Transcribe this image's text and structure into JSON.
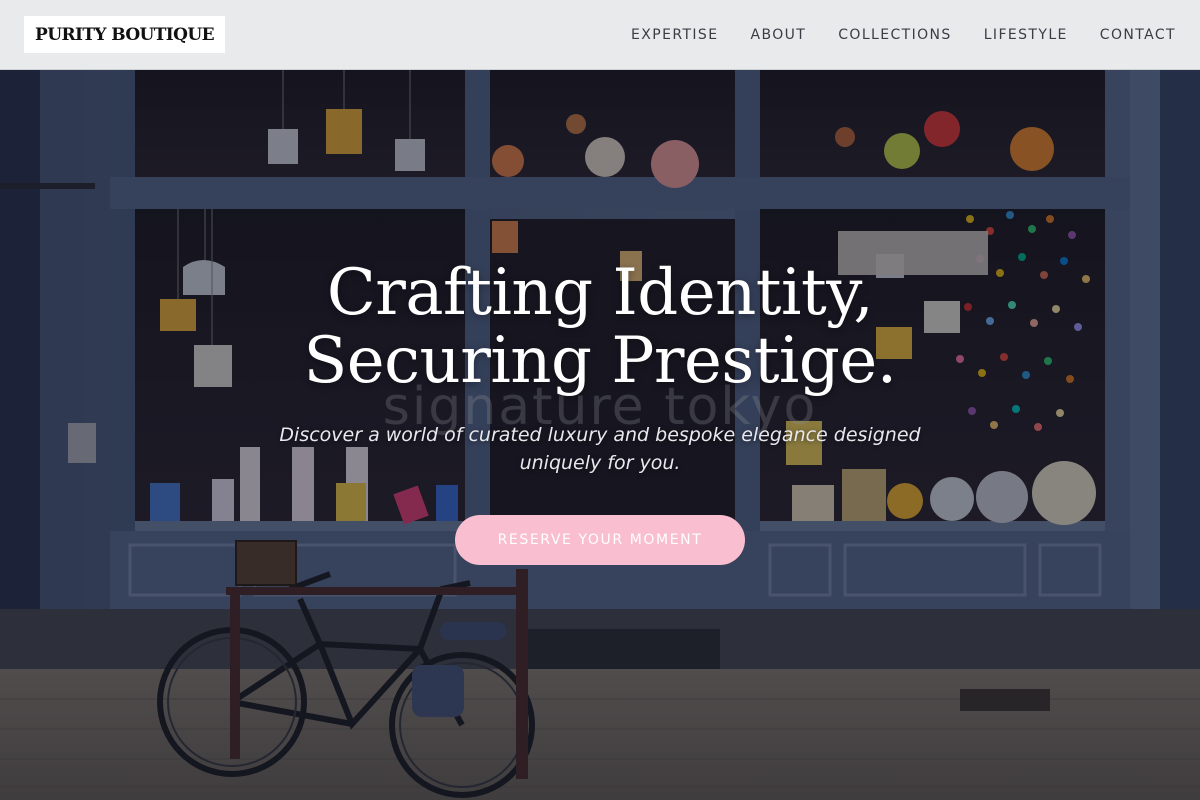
{
  "header": {
    "logo_text": "PURITY BOUTIQUE",
    "nav": [
      {
        "label": "EXPERTISE"
      },
      {
        "label": "ABOUT"
      },
      {
        "label": "COLLECTIONS"
      },
      {
        "label": "LIFESTYLE"
      },
      {
        "label": "CONTACT"
      }
    ]
  },
  "hero": {
    "title_line_1": "Crafting Identity,",
    "title_line_2": "Securing Prestige.",
    "subtitle": "Discover a world of curated luxury and bespoke elegance designed uniquely for you.",
    "cta_label": "RESERVE YOUR MOMENT",
    "background_image": "boutique-storefront-with-bicycle",
    "storefront_lettering": "signature tokyo"
  },
  "colors": {
    "header_bg": "#e9eaec",
    "cta_bg": "#f9bfd0",
    "storefront_blue": "#5f7396"
  }
}
